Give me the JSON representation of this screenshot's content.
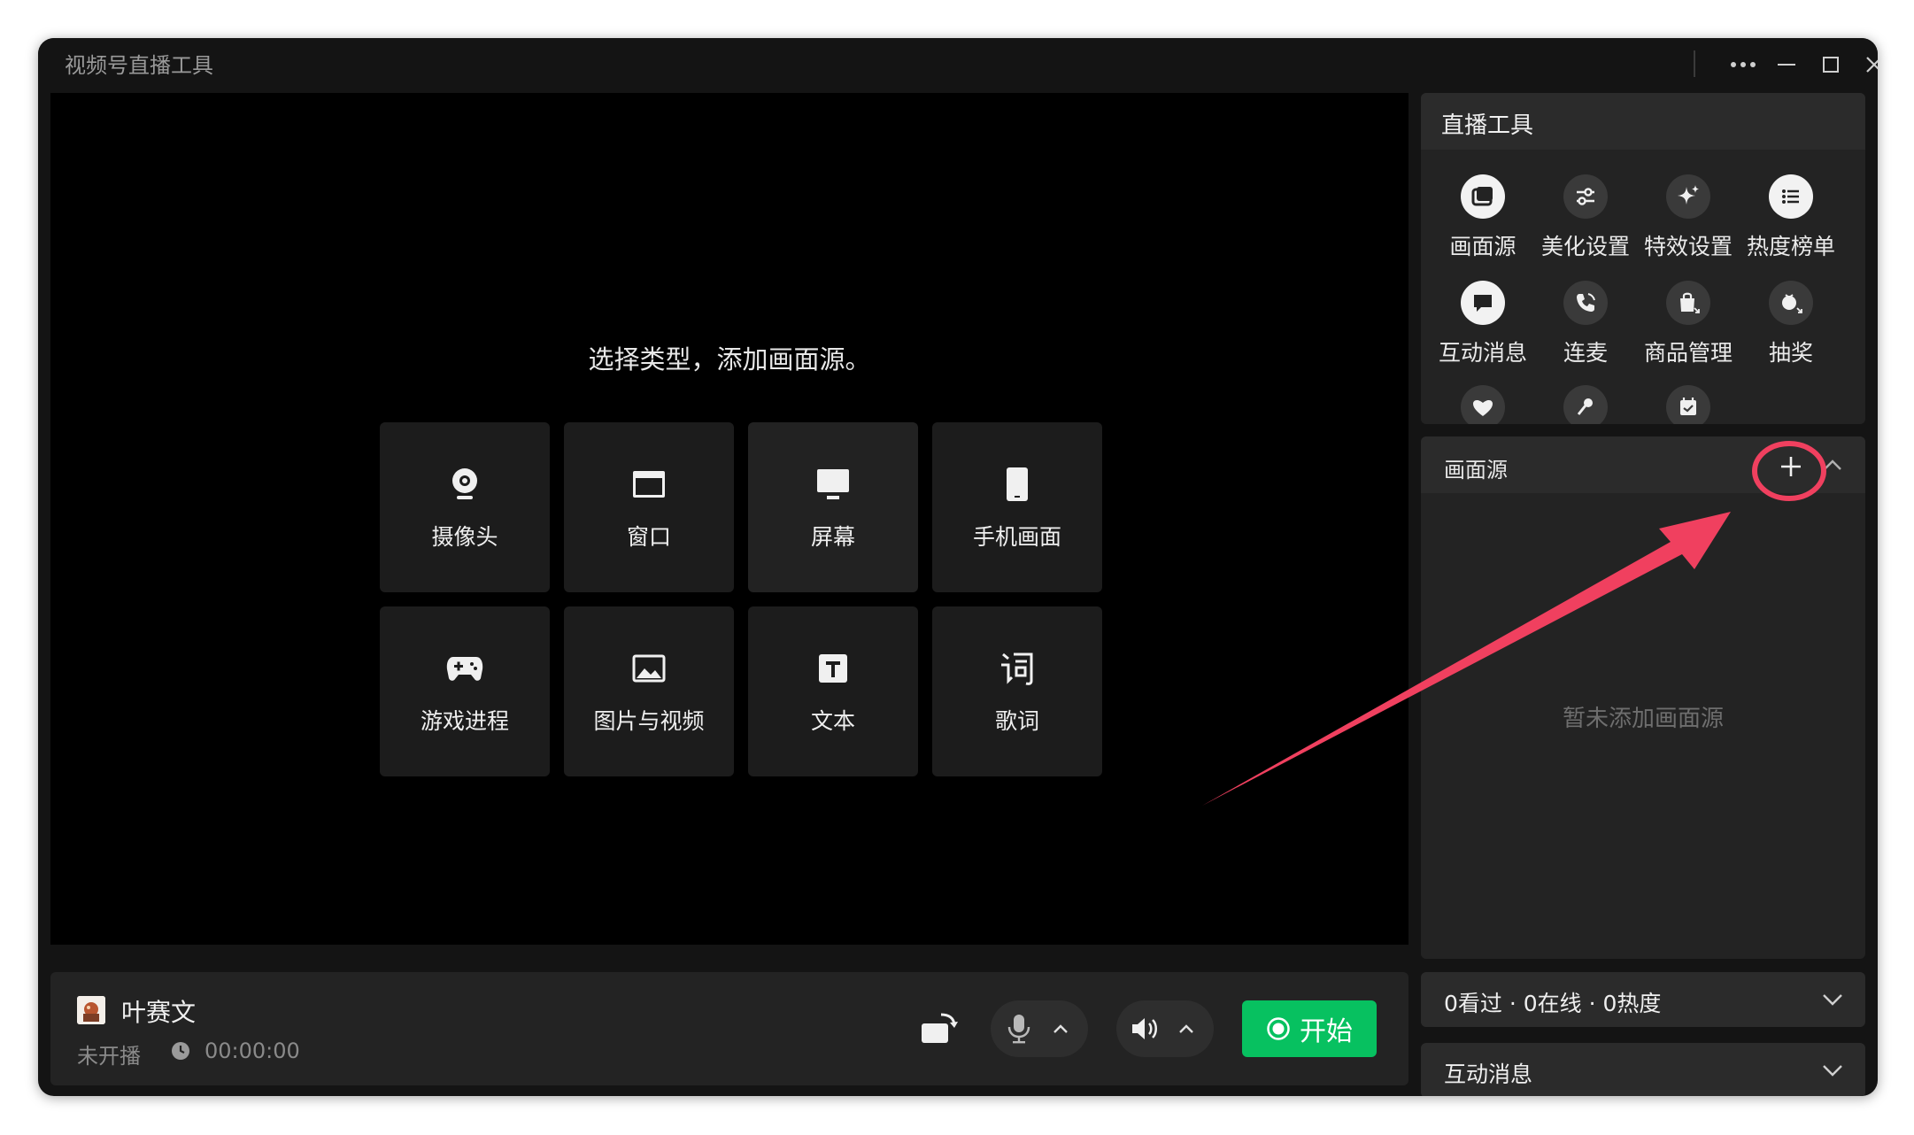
{
  "window": {
    "title": "视频号直播工具",
    "controls": [
      "more-icon",
      "minimize-icon",
      "maximize-icon",
      "close-icon"
    ]
  },
  "preview": {
    "prompt": "选择类型，添加画面源。",
    "sources": [
      {
        "label": "摄像头",
        "icon": "camera-icon"
      },
      {
        "label": "窗口",
        "icon": "window-icon"
      },
      {
        "label": "屏幕",
        "icon": "monitor-icon"
      },
      {
        "label": "手机画面",
        "icon": "phone-icon"
      },
      {
        "label": "游戏进程",
        "icon": "gamepad-icon"
      },
      {
        "label": "图片与视频",
        "icon": "image-icon"
      },
      {
        "label": "文本",
        "icon": "text-icon"
      },
      {
        "label": "歌词",
        "icon": "lyrics-icon"
      }
    ]
  },
  "bottom_bar": {
    "streamer_name": "叶赛文",
    "status": "未开播",
    "timer": "00:00:00",
    "start_label": "开始"
  },
  "tools": {
    "title": "直播工具",
    "items": [
      {
        "label": "画面源",
        "icon": "source-icon"
      },
      {
        "label": "美化设置",
        "icon": "sliders-icon"
      },
      {
        "label": "特效设置",
        "icon": "sparkle-icon"
      },
      {
        "label": "热度榜单",
        "icon": "list-icon"
      },
      {
        "label": "互动消息",
        "icon": "chat-icon"
      },
      {
        "label": "连麦",
        "icon": "phone-call-icon"
      },
      {
        "label": "商品管理",
        "icon": "shopping-bag-icon"
      },
      {
        "label": "抽奖",
        "icon": "lottery-icon"
      }
    ],
    "partial_icons": [
      "heart-icon",
      "microphone-icon",
      "calendar-icon"
    ]
  },
  "source_panel": {
    "title": "画面源",
    "empty_text": "暂未添加画面源"
  },
  "stats": {
    "text": "0看过 · 0在线 · 0热度"
  },
  "messages": {
    "title": "互动消息"
  },
  "colors": {
    "accent_green": "#07c160",
    "annotation_red": "#f0405f",
    "background": "#141414"
  }
}
